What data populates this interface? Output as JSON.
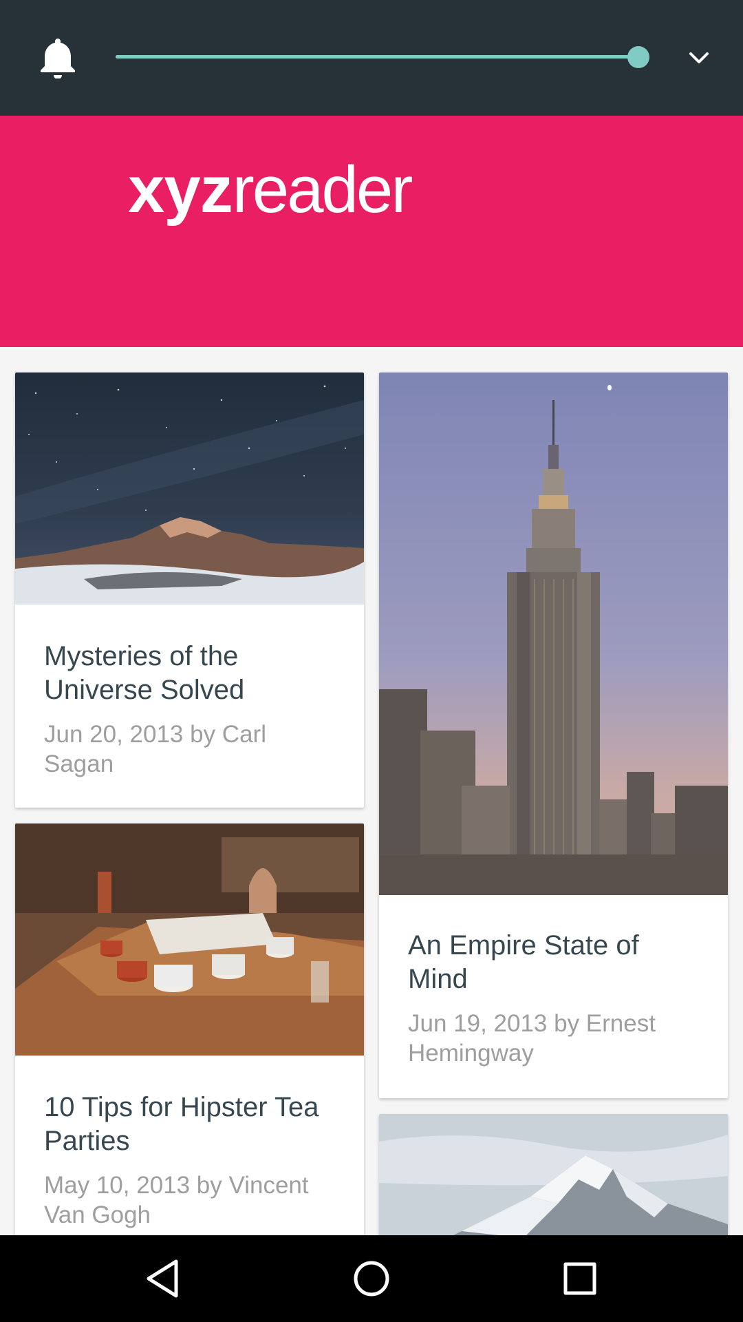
{
  "status_bar": {
    "icons": [
      "bell-icon",
      "chevron-down-icon"
    ],
    "volume_level": 1.0,
    "accent_color": "#80cbc4"
  },
  "header": {
    "logo_bold": "xyz",
    "logo_light": "reader",
    "color": "#e91e63"
  },
  "articles": [
    {
      "title": "Mysteries of the Universe Solved",
      "meta": "Jun 20, 2013 by Carl Sagan",
      "image": "night-sky-mountains"
    },
    {
      "title": "An Empire State of Mind",
      "meta": "Jun 19, 2013 by Ernest Hemingway",
      "image": "empire-state-building"
    },
    {
      "title": "10 Tips for Hipster Tea Parties",
      "meta": "May 10, 2013 by Vincent Van Gogh",
      "image": "tea-cups-table"
    },
    {
      "image": "snowy-mountain-peak"
    }
  ],
  "nav_bar": {
    "icons": [
      "back-icon",
      "home-icon",
      "recents-icon"
    ]
  }
}
